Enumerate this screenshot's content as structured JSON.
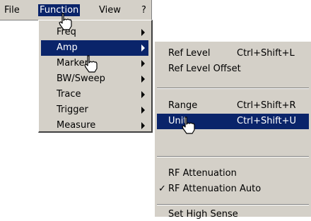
{
  "menubar": {
    "items": [
      {
        "label": "File"
      },
      {
        "label": "Function"
      },
      {
        "label": "View"
      },
      {
        "label": "?"
      }
    ]
  },
  "function_menu": {
    "items": [
      {
        "label": "Freq",
        "submenu": true
      },
      {
        "label": "Amp",
        "submenu": true,
        "highlighted": true
      },
      {
        "label": "Marker",
        "submenu": true
      },
      {
        "label": "BW/Sweep",
        "submenu": true
      },
      {
        "label": "Trace",
        "submenu": true
      },
      {
        "label": "Trigger",
        "submenu": true
      },
      {
        "label": "Measure",
        "submenu": true
      }
    ]
  },
  "amp_menu": {
    "items": [
      {
        "label": "Ref Level",
        "shortcut": "Ctrl+Shift+L"
      },
      {
        "label": "Ref Level Offset",
        "shortcut": ""
      },
      {
        "label": "Range",
        "shortcut": "Ctrl+Shift+R"
      },
      {
        "label": "Unit",
        "shortcut": "Ctrl+Shift+U",
        "highlighted": true
      },
      {
        "label": "RF Attenuation",
        "shortcut": ""
      },
      {
        "label": "RF Attenuation Auto",
        "shortcut": "",
        "checked": true
      },
      {
        "label": "Set High Sense",
        "shortcut": ""
      }
    ],
    "check_mark": "✓"
  },
  "colors": {
    "menu_bg": "#d4d0c8",
    "highlight_bg": "#0a246a",
    "highlight_fg": "#ffffff"
  }
}
